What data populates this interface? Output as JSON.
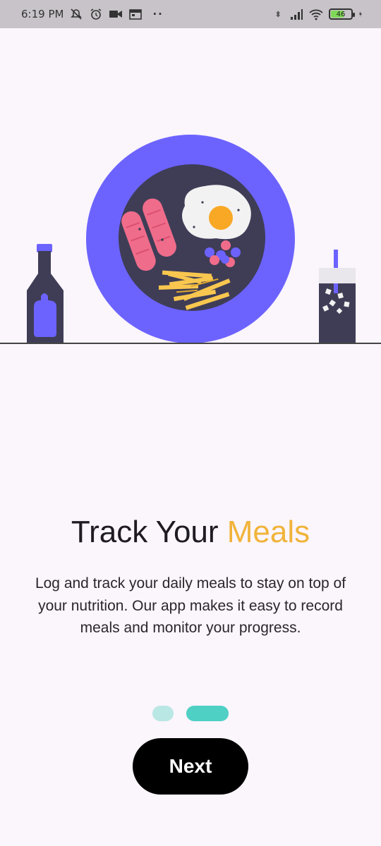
{
  "status_bar": {
    "time": "6:19 PM",
    "left_icons": [
      "notifications-off-icon",
      "alarm-icon",
      "video-camera-icon",
      "calendar-icon"
    ],
    "more": "··",
    "right_icons": [
      "bluetooth-icon",
      "signal-icon",
      "wifi-icon",
      "battery-icon",
      "charging-icon"
    ],
    "battery_level": "46"
  },
  "illustration": {
    "items": [
      "ketchup-bottle",
      "plate-with-sausages-egg-berries-fries",
      "iced-drink-glass"
    ],
    "colors": {
      "plate_rim": "#6c63ff",
      "plate_center": "#3f3d56",
      "sausage": "#f06c8b",
      "egg_white": "#f2f2f2",
      "yolk": "#f9a825",
      "fries": "#f9c74f",
      "berries": "#6c63ff"
    }
  },
  "onboarding": {
    "title_prefix": "Track Your",
    "title_highlight": "Meals",
    "description": "Log and track your daily meals to stay on top of your nutrition. Our app makes it easy to record meals and monitor your progress.",
    "page_indicator": {
      "total": 2,
      "active": 2
    },
    "next_label": "Next"
  },
  "colors": {
    "background": "#fbf5fc",
    "accent": "#f0b43a",
    "indicator_active": "#4fd0c4",
    "indicator_inactive": "#b9e7e4",
    "button": "#000000"
  }
}
